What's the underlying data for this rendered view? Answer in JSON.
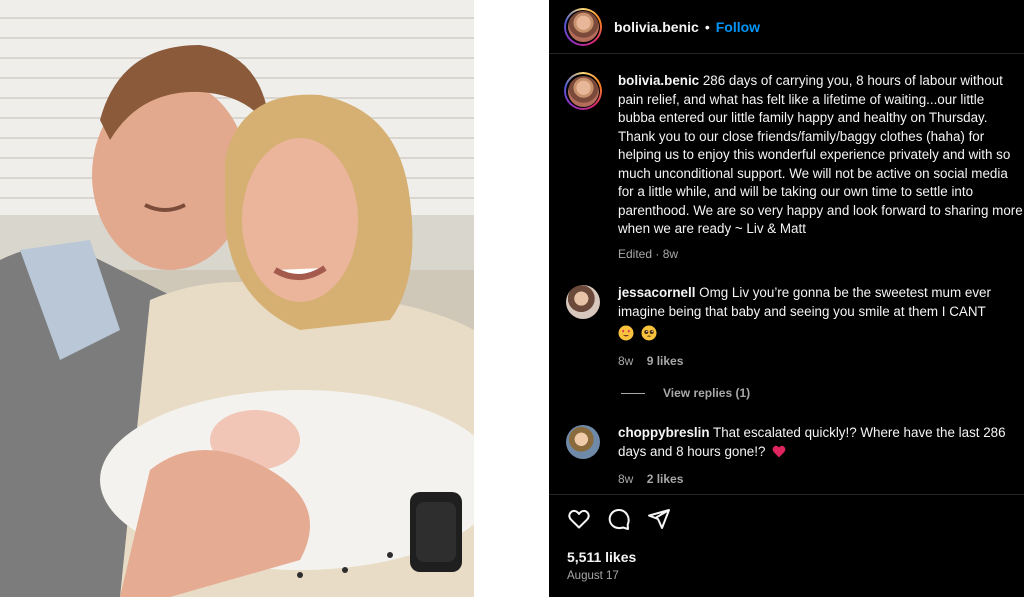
{
  "post": {
    "author": "bolivia.benic",
    "follow_label": "Follow",
    "separator": "•",
    "caption": "286 days of carrying you, 8 hours of labour without pain relief, and what has felt like a lifetime of waiting...our little bubba entered our little family happy and healthy on Thursday. Thank you to our close friends/family/baggy clothes (haha) for helping us to enjoy this wonderful experience privately and with so much unconditional support. We will not be active on social media for a little while, and will be taking our own time to settle into parenthood. We are so very happy and look forward to sharing more when we are ready ~ Liv & Matt",
    "edited_label": "Edited",
    "meta_separator": "·",
    "age": "8w",
    "likes": "5,511 likes",
    "date": "August 17"
  },
  "comments": [
    {
      "user": "jessacornell",
      "text": "Omg Liv you’re gonna be the sweetest mum ever imagine being that baby and seeing you smile at them I CANT",
      "emojis": [
        "heart-eyes-emoji",
        "pleading-face-emoji"
      ],
      "age": "8w",
      "likes": "9 likes",
      "view_replies": "View replies (1)"
    },
    {
      "user": "choppybreslin",
      "text": "That escalated quickly!? Where have the last 286 days and 8 hours gone!?",
      "emojis": [
        "red-heart-emoji"
      ],
      "age": "8w",
      "likes": "2 likes"
    }
  ],
  "icons": [
    "heart-icon",
    "comment-icon",
    "share-icon"
  ],
  "colors": {
    "panel_bg": "#000000",
    "follow": "#0095f6",
    "muted": "#a8a8a8",
    "heart": "#ed4956"
  }
}
